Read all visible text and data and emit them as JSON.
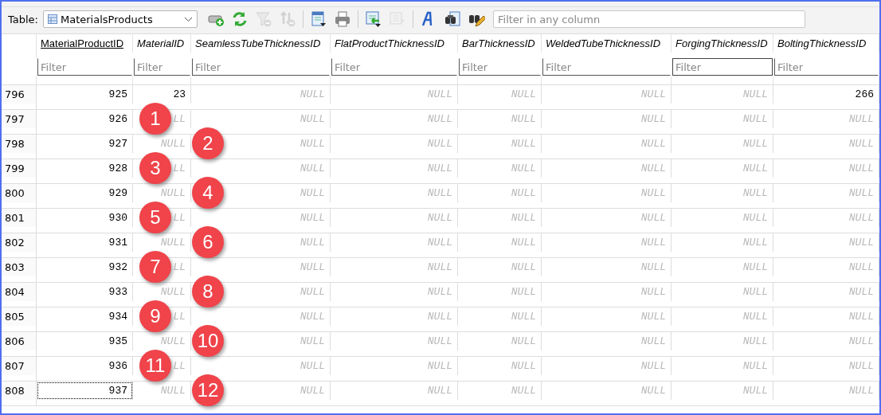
{
  "toolbar": {
    "table_label": "Table:",
    "table_name": "MaterialsProducts",
    "filter_placeholder": "Filter in any column",
    "tools": [
      {
        "kind": "add-row",
        "disabled": false
      },
      {
        "kind": "refresh",
        "disabled": false
      },
      {
        "kind": "clear-filter",
        "disabled": true
      },
      {
        "kind": "clear-sort",
        "disabled": true
      },
      {
        "kind": "export",
        "disabled": false
      },
      {
        "kind": "print",
        "disabled": false
      },
      {
        "kind": "import",
        "disabled": false
      },
      {
        "kind": "export-rows",
        "disabled": true
      },
      {
        "kind": "font",
        "disabled": false
      },
      {
        "kind": "find",
        "disabled": false
      },
      {
        "kind": "edit",
        "disabled": false
      }
    ]
  },
  "grid": {
    "columns": [
      {
        "title": "MaterialProductID",
        "underlined": true
      },
      {
        "title": "MaterialID",
        "underlined": false
      },
      {
        "title": "SeamlessTubeThicknessID",
        "underlined": false
      },
      {
        "title": "FlatProductThicknessID",
        "underlined": false
      },
      {
        "title": "BarThicknessID",
        "underlined": false
      },
      {
        "title": "WeldedTubeThicknessID",
        "underlined": false
      },
      {
        "title": "ForgingThicknessID",
        "underlined": false
      },
      {
        "title": "BoltingThicknessID",
        "underlined": false
      }
    ],
    "filters": [
      {
        "placeholder": "Filter",
        "focused": false
      },
      {
        "placeholder": "Filter",
        "focused": false
      },
      {
        "placeholder": "Filter",
        "focused": false
      },
      {
        "placeholder": "Filter",
        "focused": false
      },
      {
        "placeholder": "Filter",
        "focused": false
      },
      {
        "placeholder": "Filter",
        "focused": false
      },
      {
        "placeholder": "Filter",
        "focused": true
      },
      {
        "placeholder": "Filter",
        "focused": false
      }
    ],
    "rows": [
      {
        "row_number": "796",
        "current": false,
        "cells": [
          {
            "text": "925",
            "null": false
          },
          {
            "text": "23",
            "null": false
          },
          {
            "text": "NULL",
            "null": true
          },
          {
            "text": "NULL",
            "null": true
          },
          {
            "text": "NULL",
            "null": true
          },
          {
            "text": "NULL",
            "null": true
          },
          {
            "text": "NULL",
            "null": true
          },
          {
            "text": "266",
            "null": false
          }
        ]
      },
      {
        "row_number": "797",
        "current": false,
        "callout": "1",
        "cells": [
          {
            "text": "926",
            "null": false
          },
          {
            "text": "LL",
            "null": true
          },
          {
            "text": "NULL",
            "null": true
          },
          {
            "text": "NULL",
            "null": true
          },
          {
            "text": "NULL",
            "null": true
          },
          {
            "text": "NULL",
            "null": true
          },
          {
            "text": "NULL",
            "null": true
          },
          {
            "text": "NULL",
            "null": true
          }
        ]
      },
      {
        "row_number": "798",
        "current": false,
        "callout": "2",
        "cells": [
          {
            "text": "927",
            "null": false
          },
          {
            "text": "NULL",
            "null": true
          },
          {
            "text": "NULL",
            "null": true
          },
          {
            "text": "NULL",
            "null": true
          },
          {
            "text": "NULL",
            "null": true
          },
          {
            "text": "NULL",
            "null": true
          },
          {
            "text": "NULL",
            "null": true
          },
          {
            "text": "NULL",
            "null": true
          }
        ]
      },
      {
        "row_number": "799",
        "current": false,
        "callout": "3",
        "cells": [
          {
            "text": "928",
            "null": false
          },
          {
            "text": "LL",
            "null": true
          },
          {
            "text": "NULL",
            "null": true
          },
          {
            "text": "NULL",
            "null": true
          },
          {
            "text": "NULL",
            "null": true
          },
          {
            "text": "NULL",
            "null": true
          },
          {
            "text": "NULL",
            "null": true
          },
          {
            "text": "NULL",
            "null": true
          }
        ]
      },
      {
        "row_number": "800",
        "current": false,
        "callout": "4",
        "cells": [
          {
            "text": "929",
            "null": false
          },
          {
            "text": "NULL",
            "null": true
          },
          {
            "text": "NULL",
            "null": true
          },
          {
            "text": "NULL",
            "null": true
          },
          {
            "text": "NULL",
            "null": true
          },
          {
            "text": "NULL",
            "null": true
          },
          {
            "text": "NULL",
            "null": true
          },
          {
            "text": "NULL",
            "null": true
          }
        ]
      },
      {
        "row_number": "801",
        "current": false,
        "callout": "5",
        "cells": [
          {
            "text": "930",
            "null": false
          },
          {
            "text": "LL",
            "null": true
          },
          {
            "text": "NULL",
            "null": true
          },
          {
            "text": "NULL",
            "null": true
          },
          {
            "text": "NULL",
            "null": true
          },
          {
            "text": "NULL",
            "null": true
          },
          {
            "text": "NULL",
            "null": true
          },
          {
            "text": "NULL",
            "null": true
          }
        ]
      },
      {
        "row_number": "802",
        "current": false,
        "callout": "6",
        "cells": [
          {
            "text": "931",
            "null": false
          },
          {
            "text": "NULL",
            "null": true
          },
          {
            "text": "NULL",
            "null": true
          },
          {
            "text": "NULL",
            "null": true
          },
          {
            "text": "NULL",
            "null": true
          },
          {
            "text": "NULL",
            "null": true
          },
          {
            "text": "NULL",
            "null": true
          },
          {
            "text": "NULL",
            "null": true
          }
        ]
      },
      {
        "row_number": "803",
        "current": false,
        "callout": "7",
        "cells": [
          {
            "text": "932",
            "null": false
          },
          {
            "text": "LL",
            "null": true
          },
          {
            "text": "NULL",
            "null": true
          },
          {
            "text": "NULL",
            "null": true
          },
          {
            "text": "NULL",
            "null": true
          },
          {
            "text": "NULL",
            "null": true
          },
          {
            "text": "NULL",
            "null": true
          },
          {
            "text": "NULL",
            "null": true
          }
        ]
      },
      {
        "row_number": "804",
        "current": false,
        "callout": "8",
        "cells": [
          {
            "text": "933",
            "null": false
          },
          {
            "text": "NULL",
            "null": true
          },
          {
            "text": "NULL",
            "null": true
          },
          {
            "text": "NULL",
            "null": true
          },
          {
            "text": "NULL",
            "null": true
          },
          {
            "text": "NULL",
            "null": true
          },
          {
            "text": "NULL",
            "null": true
          },
          {
            "text": "NULL",
            "null": true
          }
        ]
      },
      {
        "row_number": "805",
        "current": false,
        "callout": "9",
        "cells": [
          {
            "text": "934",
            "null": false
          },
          {
            "text": "LL",
            "null": true
          },
          {
            "text": "NULL",
            "null": true
          },
          {
            "text": "NULL",
            "null": true
          },
          {
            "text": "NULL",
            "null": true
          },
          {
            "text": "NULL",
            "null": true
          },
          {
            "text": "NULL",
            "null": true
          },
          {
            "text": "NULL",
            "null": true
          }
        ]
      },
      {
        "row_number": "806",
        "current": false,
        "callout": "10",
        "cells": [
          {
            "text": "935",
            "null": false
          },
          {
            "text": "NULL",
            "null": true
          },
          {
            "text": "NULL",
            "null": true
          },
          {
            "text": "NULL",
            "null": true
          },
          {
            "text": "NULL",
            "null": true
          },
          {
            "text": "NULL",
            "null": true
          },
          {
            "text": "NULL",
            "null": true
          },
          {
            "text": "NULL",
            "null": true
          }
        ]
      },
      {
        "row_number": "807",
        "current": false,
        "callout": "11",
        "cells": [
          {
            "text": "936",
            "null": false
          },
          {
            "text": "LL",
            "null": true
          },
          {
            "text": "NULL",
            "null": true
          },
          {
            "text": "NULL",
            "null": true
          },
          {
            "text": "NULL",
            "null": true
          },
          {
            "text": "NULL",
            "null": true
          },
          {
            "text": "NULL",
            "null": true
          },
          {
            "text": "NULL",
            "null": true
          }
        ]
      },
      {
        "row_number": "808",
        "current": true,
        "callout": "12",
        "cells": [
          {
            "text": "937",
            "null": false
          },
          {
            "text": "NULL",
            "null": true
          },
          {
            "text": "NULL",
            "null": true
          },
          {
            "text": "NULL",
            "null": true
          },
          {
            "text": "NULL",
            "null": true
          },
          {
            "text": "NULL",
            "null": true
          },
          {
            "text": "NULL",
            "null": true
          },
          {
            "text": "NULL",
            "null": true
          }
        ]
      }
    ]
  }
}
